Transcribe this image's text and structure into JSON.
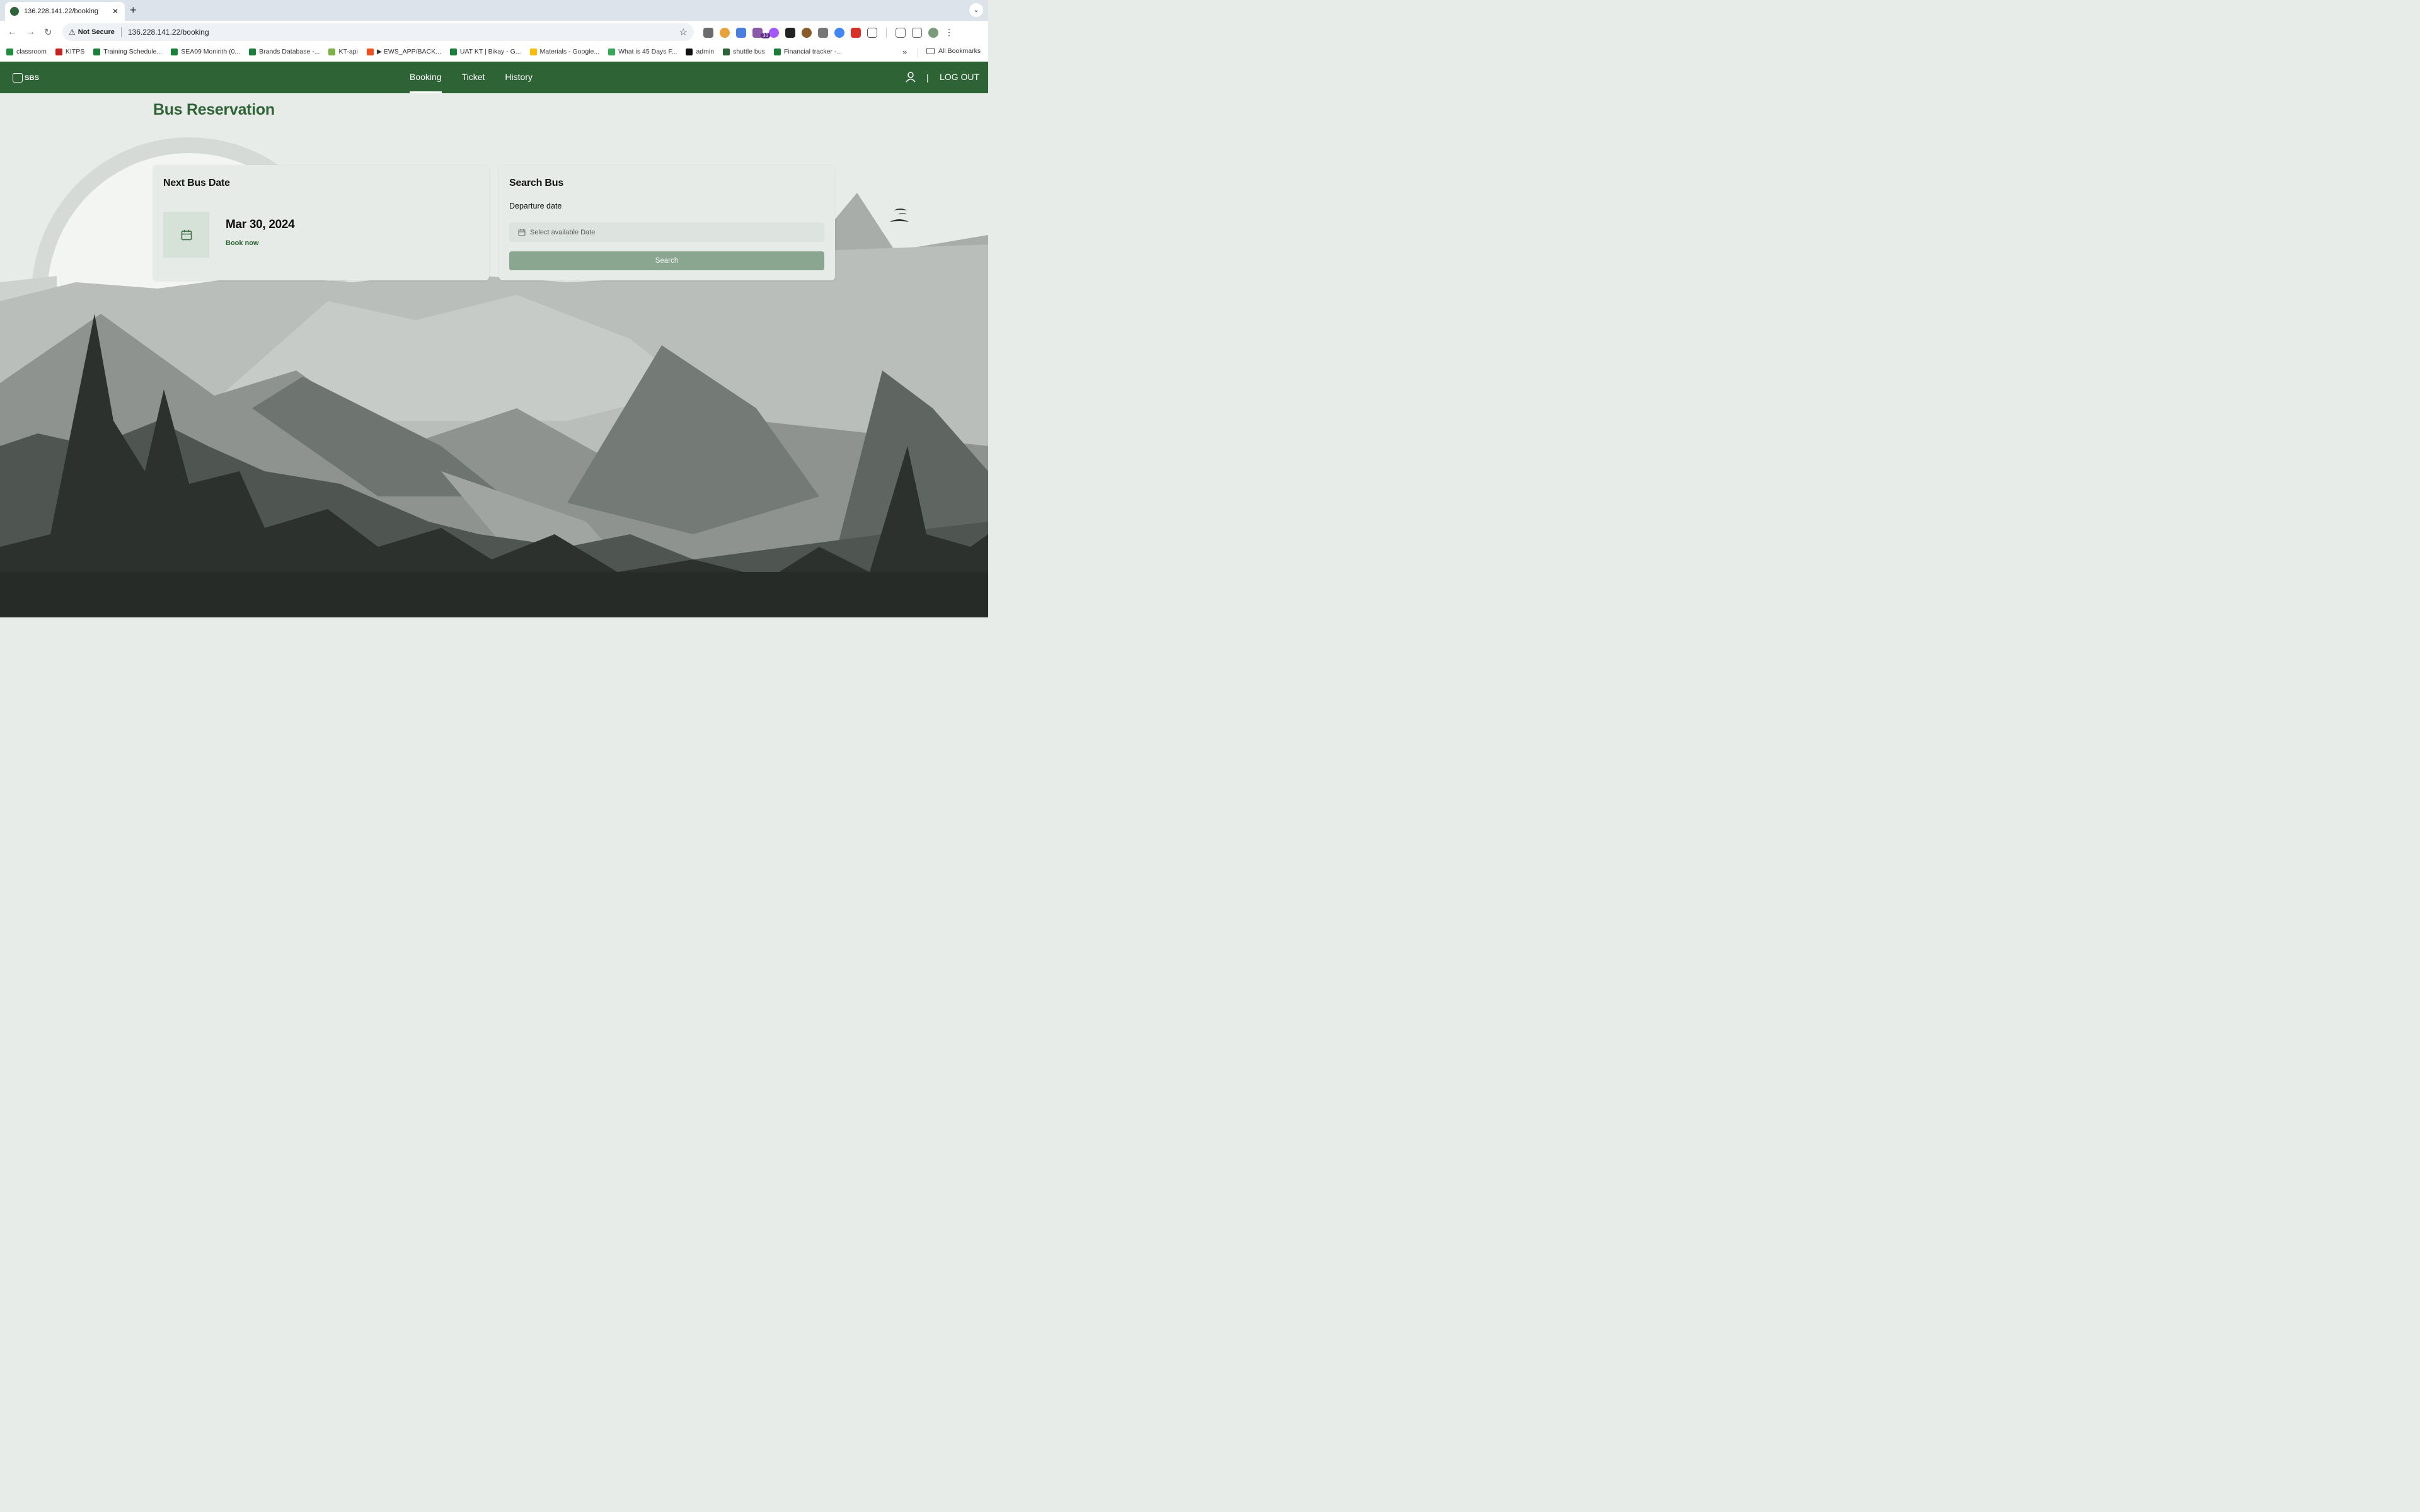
{
  "browser": {
    "tab_title": "136.228.141.22/booking",
    "tab_close": "✕",
    "new_tab": "+",
    "security_label": "Not Secure",
    "url": "136.228.141.22/booking",
    "extension_badge": "36",
    "bookmarks": [
      {
        "label": "classroom",
        "color": "#1e8e3e"
      },
      {
        "label": "KITPS",
        "color": "#c5221f"
      },
      {
        "label": "Training Schedule...",
        "color": "#188038"
      },
      {
        "label": "SEA09 Monirith (0...",
        "color": "#188038"
      },
      {
        "label": "Brands Database -...",
        "color": "#188038"
      },
      {
        "label": "KT-api",
        "color": "#7cb342"
      },
      {
        "label": "▶ EWS_APP/BACK...",
        "color": "#f24e1e"
      },
      {
        "label": "UAT KT | Bikay - G...",
        "color": "#188038"
      },
      {
        "label": "Materials - Google...",
        "color": "#fbbc04"
      },
      {
        "label": "What is 45 Days F...",
        "color": "#34a853"
      },
      {
        "label": "admin",
        "color": "#111111"
      },
      {
        "label": "shuttle bus",
        "color": "#2e6336"
      },
      {
        "label": "Financial tracker -...",
        "color": "#188038"
      }
    ],
    "bookmarks_more": "»",
    "all_bookmarks": "All Bookmarks"
  },
  "app": {
    "logo_text": "SBS",
    "brand_color": "#2e6336",
    "nav": [
      {
        "label": "Booking",
        "active": true
      },
      {
        "label": "Ticket",
        "active": false
      },
      {
        "label": "History",
        "active": false
      }
    ],
    "separator": "|",
    "logout_label": "LOG OUT"
  },
  "page": {
    "title": "Bus Reservation",
    "next_bus": {
      "heading": "Next Bus Date",
      "date": "Mar 30, 2024",
      "action": "Book now"
    },
    "search": {
      "heading": "Search Bus",
      "departure_label": "Departure date",
      "date_placeholder": "Select available Date",
      "button": "Search"
    }
  }
}
